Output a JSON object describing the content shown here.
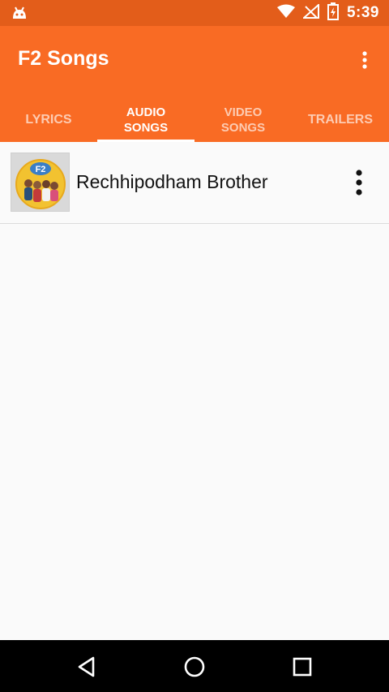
{
  "status_bar": {
    "time": "5:39",
    "icons": [
      "android-icon",
      "wifi-icon",
      "no-signal-icon",
      "battery-charging-icon"
    ]
  },
  "app_bar": {
    "title": "F2 Songs",
    "menu_icon": "more-vert-icon",
    "background_color": "#f96b24"
  },
  "tabs": [
    {
      "label": "LYRICS",
      "active": false
    },
    {
      "label": "AUDIO\nSONGS",
      "active": true
    },
    {
      "label": "VIDEO\nSONGS",
      "active": false
    },
    {
      "label": "TRAILERS",
      "active": false
    }
  ],
  "songs": [
    {
      "title": "Rechhipodham Brother",
      "thumbnail_text": "F2",
      "menu_icon": "more-vert-icon"
    }
  ],
  "nav_bar": {
    "buttons": [
      "back-icon",
      "home-icon",
      "recents-icon"
    ]
  }
}
